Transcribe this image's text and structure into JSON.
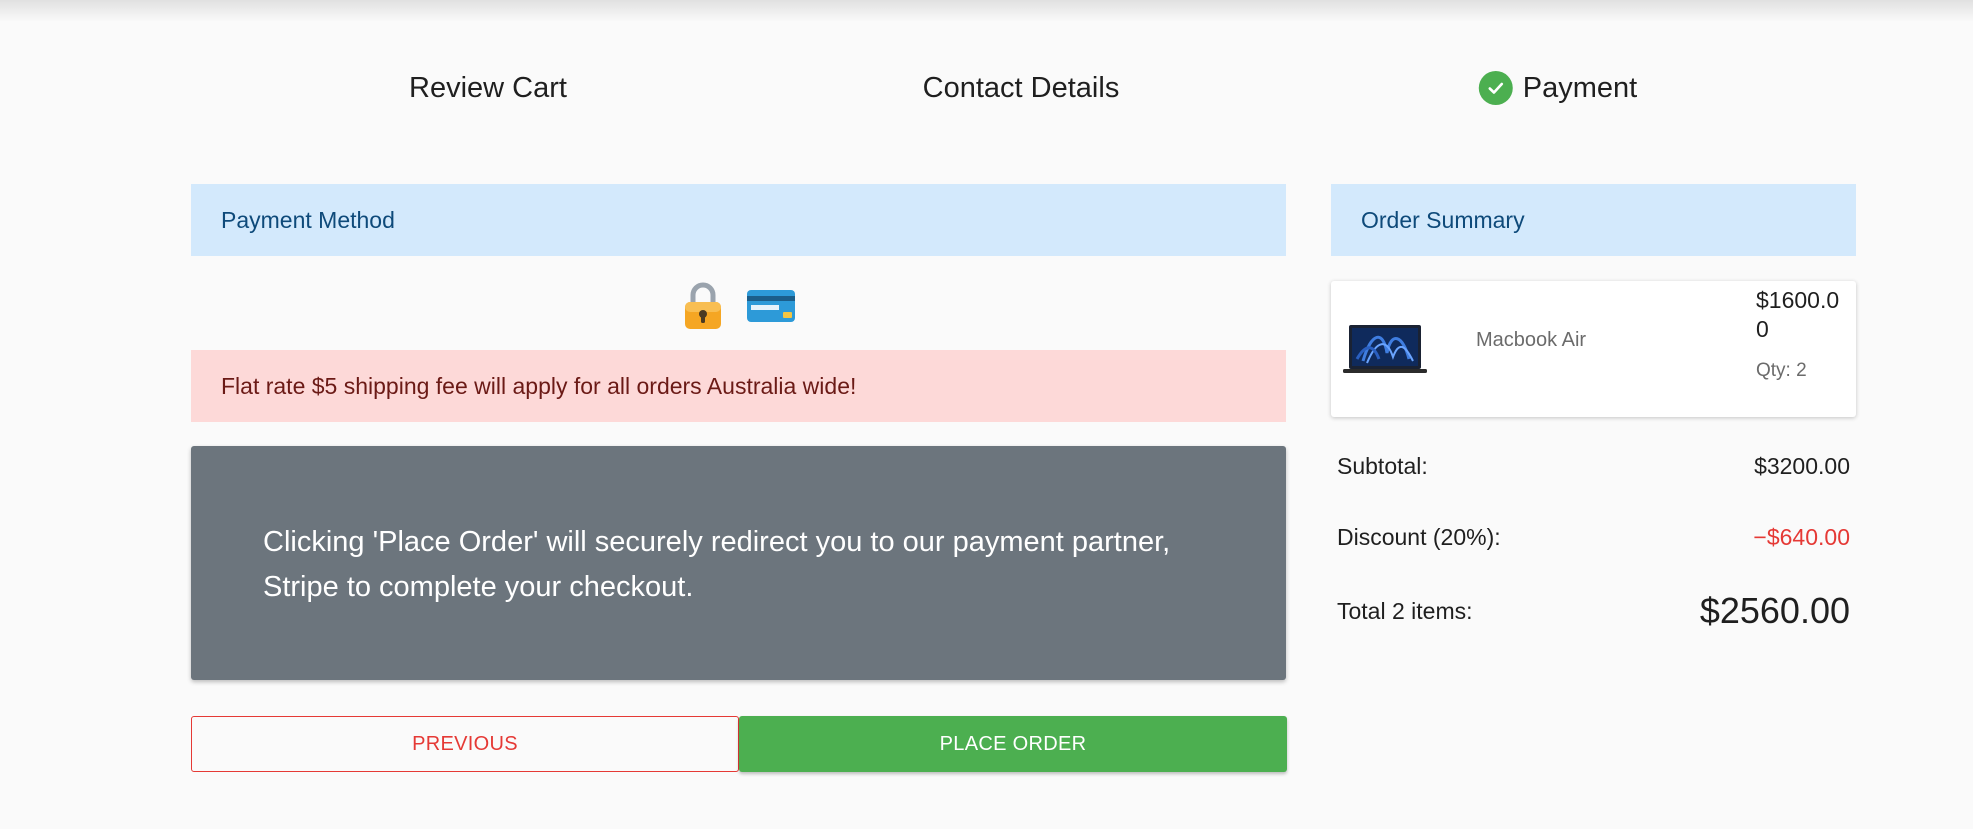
{
  "stepper": {
    "steps": [
      {
        "label": "Review Cart",
        "completed": false
      },
      {
        "label": "Contact Details",
        "completed": false
      },
      {
        "label": "Payment",
        "completed": true
      }
    ],
    "completed_color": "#4caf50"
  },
  "payment": {
    "header": "Payment Method",
    "icons": [
      "lock-icon",
      "credit-card-icon"
    ],
    "notice": "Flat rate $5 shipping fee will apply for all orders Australia wide!",
    "info": "Clicking 'Place Order' will securely redirect you to our payment partner, Stripe to complete your checkout.",
    "previous_label": "PREVIOUS",
    "place_order_label": "PLACE ORDER"
  },
  "summary": {
    "header": "Order Summary",
    "items": [
      {
        "name": "Macbook Air",
        "price": "$1600.00",
        "qty": "Qty: 2",
        "image_icon": "laptop-icon"
      }
    ],
    "subtotal_label": "Subtotal:",
    "subtotal_value": "$3200.00",
    "discount_label": "Discount (20%):",
    "discount_value": "−$640.00",
    "total_label": "Total 2 items:",
    "total_value": "$2560.00"
  },
  "colors": {
    "header_bg": "#d3e9fc",
    "notice_bg": "#fdd9d8",
    "info_bg": "#6c757d",
    "primary_green": "#4caf50",
    "danger_red": "#e53935"
  }
}
